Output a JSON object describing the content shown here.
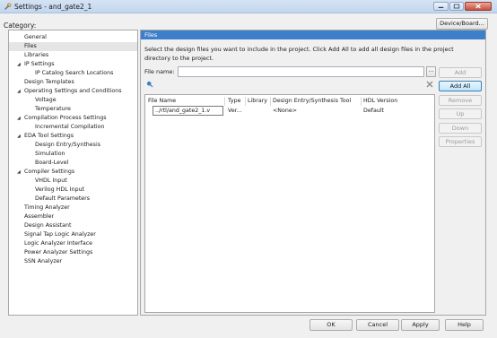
{
  "window": {
    "title": "Settings - and_gate2_1",
    "icon": "wrench-icon",
    "controls": [
      "minimize-icon",
      "maximize-icon",
      "close-icon"
    ]
  },
  "category_label": "Category:",
  "device_button": "Device/Board...",
  "tree": {
    "selected": "Files",
    "items": [
      {
        "label": "General",
        "level": 1,
        "expandable": false
      },
      {
        "label": "Files",
        "level": 1,
        "expandable": false
      },
      {
        "label": "Libraries",
        "level": 1,
        "expandable": false
      },
      {
        "label": "IP Settings",
        "level": 1,
        "expandable": true
      },
      {
        "label": "IP Catalog Search Locations",
        "level": 2,
        "expandable": false
      },
      {
        "label": "Design Templates",
        "level": 1,
        "expandable": false
      },
      {
        "label": "Operating Settings and Conditions",
        "level": 1,
        "expandable": true
      },
      {
        "label": "Voltage",
        "level": 2,
        "expandable": false
      },
      {
        "label": "Temperature",
        "level": 2,
        "expandable": false
      },
      {
        "label": "Compilation Process Settings",
        "level": 1,
        "expandable": true
      },
      {
        "label": "Incremental Compilation",
        "level": 2,
        "expandable": false
      },
      {
        "label": "EDA Tool Settings",
        "level": 1,
        "expandable": true
      },
      {
        "label": "Design Entry/Synthesis",
        "level": 2,
        "expandable": false
      },
      {
        "label": "Simulation",
        "level": 2,
        "expandable": false
      },
      {
        "label": "Board-Level",
        "level": 2,
        "expandable": false
      },
      {
        "label": "Compiler Settings",
        "level": 1,
        "expandable": true
      },
      {
        "label": "VHDL Input",
        "level": 2,
        "expandable": false
      },
      {
        "label": "Verilog HDL Input",
        "level": 2,
        "expandable": false
      },
      {
        "label": "Default Parameters",
        "level": 2,
        "expandable": false
      },
      {
        "label": "Timing Analyzer",
        "level": 1,
        "expandable": false
      },
      {
        "label": "Assembler",
        "level": 1,
        "expandable": false
      },
      {
        "label": "Design Assistant",
        "level": 1,
        "expandable": false
      },
      {
        "label": "Signal Tap Logic Analyzer",
        "level": 1,
        "expandable": false
      },
      {
        "label": "Logic Analyzer Interface",
        "level": 1,
        "expandable": false
      },
      {
        "label": "Power Analyzer Settings",
        "level": 1,
        "expandable": false
      },
      {
        "label": "SSN Analyzer",
        "level": 1,
        "expandable": false
      }
    ]
  },
  "panel": {
    "header": "Files",
    "description": "Select the design files you want to include in the project. Click Add All to add all design files in the project directory to the project.",
    "file_name_label": "File name:",
    "file_name_value": "",
    "browse_label": "...",
    "filter_icon": "search-icon",
    "clear_icon": "clear-icon",
    "table": {
      "columns": [
        "File Name",
        "Type",
        "Library",
        "Design Entry/Synthesis Tool",
        "HDL Version"
      ],
      "rows": [
        {
          "file_name": "../rtl/and_gate2_1.v",
          "type": "Ver...",
          "library": "",
          "tool": "<None>",
          "hdl_version": "Default"
        }
      ]
    }
  },
  "side_buttons": [
    {
      "label": "Add",
      "enabled": false
    },
    {
      "label": "Add All",
      "enabled": true
    },
    {
      "label": "Remove",
      "enabled": false
    },
    {
      "label": "Up",
      "enabled": false
    },
    {
      "label": "Down",
      "enabled": false
    },
    {
      "label": "Properties",
      "enabled": false
    }
  ],
  "footer": {
    "ok": "OK",
    "cancel": "Cancel",
    "apply": "Apply",
    "help": "Help"
  }
}
